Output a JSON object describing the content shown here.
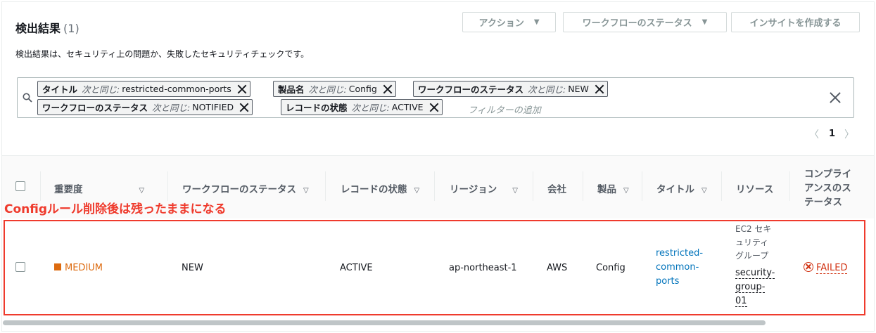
{
  "header": {
    "title": "検出結果",
    "count": "(1)",
    "description": "検出結果は、セキュリティ上の問題か、失敗したセキュリティチェックです。",
    "buttons": {
      "actions": "アクション",
      "workflow_status": "ワークフローのステータス",
      "create_insight": "インサイトを作成する"
    }
  },
  "filters": {
    "tokens": [
      {
        "key": "タイトル",
        "op": "次と同じ:",
        "value": "restricted-common-ports"
      },
      {
        "key": "製品名",
        "op": "次と同じ:",
        "value": "Config"
      },
      {
        "key": "ワークフローのステータス",
        "op": "次と同じ:",
        "value": "NEW"
      },
      {
        "key": "ワークフローのステータス",
        "op": "次と同じ:",
        "value": "NOTIFIED"
      },
      {
        "key": "レコードの状態",
        "op": "次と同じ:",
        "value": "ACTIVE"
      }
    ],
    "placeholder": "フィルターの追加"
  },
  "pagination": {
    "current_page": "1"
  },
  "table": {
    "columns": {
      "severity": "重要度",
      "workflow": "ワークフローのステータス",
      "record_state": "レコードの状態",
      "region": "リージョン",
      "company": "会社",
      "product": "製品",
      "title": "タイトル",
      "resource": "リソース",
      "compliance_1": "コンプライ",
      "compliance_2": "アンスのス",
      "compliance_3": "テータス"
    },
    "row": {
      "severity": "MEDIUM",
      "workflow": "NEW",
      "record_state": "ACTIVE",
      "region": "ap-northeast-1",
      "company": "AWS",
      "product": "Config",
      "title_1": "restricted-",
      "title_2": "common-",
      "title_3": "ports",
      "resource_type_1": "EC2 セキ",
      "resource_type_2": "ュリティ",
      "resource_type_3": "グループ",
      "resource_id_1": "security-",
      "resource_id_2": "group-",
      "resource_id_3": "01",
      "compliance": "FAILED"
    }
  },
  "annotation": "Configルール削除後は残ったままになる",
  "colors": {
    "annotation": "#ef3b2d",
    "severity_medium": "#dd6b10",
    "failed": "#d13212",
    "link": "#0073bb"
  }
}
